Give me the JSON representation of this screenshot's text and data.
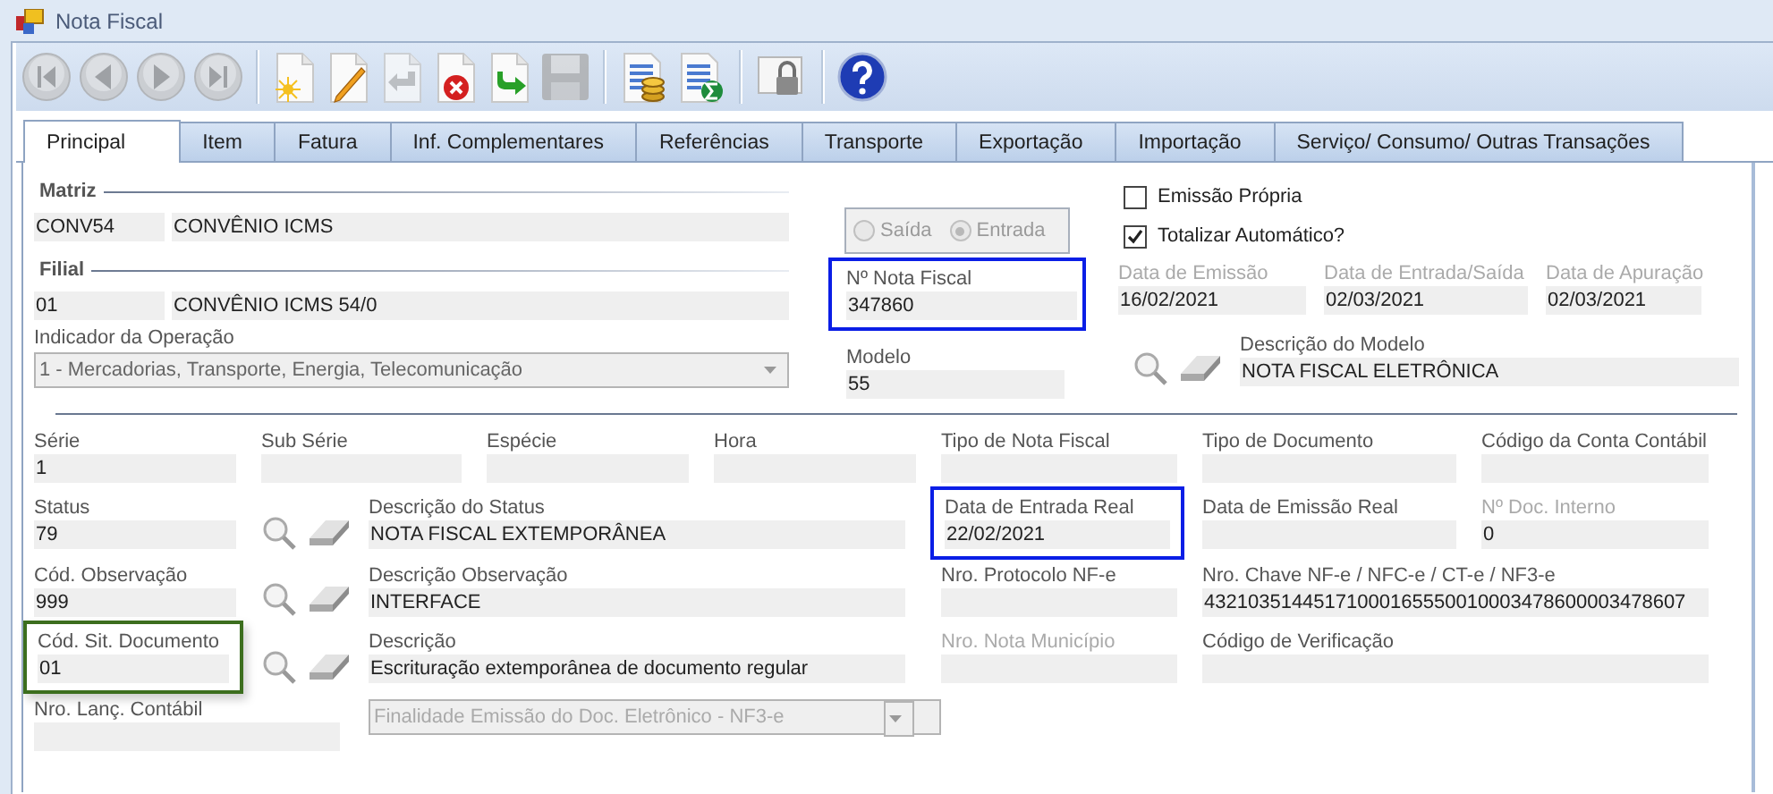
{
  "window": {
    "title": "Nota Fiscal"
  },
  "toolbar": [
    {
      "kind": "first",
      "disabled": true
    },
    {
      "kind": "prev",
      "disabled": true
    },
    {
      "kind": "next",
      "disabled": true
    },
    {
      "kind": "last",
      "disabled": true
    },
    {
      "kind": "separator"
    },
    {
      "kind": "new",
      "disabled": false
    },
    {
      "kind": "edit",
      "disabled": false
    },
    {
      "kind": "undo",
      "disabled": true
    },
    {
      "kind": "delete",
      "disabled": false
    },
    {
      "kind": "export",
      "disabled": false
    },
    {
      "kind": "save",
      "disabled": true
    },
    {
      "kind": "separator"
    },
    {
      "kind": "sheet-coins",
      "disabled": false
    },
    {
      "kind": "sheet-sum",
      "disabled": false
    },
    {
      "kind": "separator"
    },
    {
      "kind": "lock",
      "disabled": false
    },
    {
      "kind": "separator"
    },
    {
      "kind": "help",
      "disabled": false
    }
  ],
  "tabs": [
    {
      "label": "Principal",
      "selected": true
    },
    {
      "label": "Item",
      "selected": false
    },
    {
      "label": "Fatura",
      "selected": false
    },
    {
      "label": "Inf. Complementares",
      "selected": false
    },
    {
      "label": "Referências",
      "selected": false
    },
    {
      "label": "Transporte",
      "selected": false
    },
    {
      "label": "Exportação",
      "selected": false
    },
    {
      "label": "Importação",
      "selected": false
    },
    {
      "label": "Serviço/ Consumo/ Outras Transações",
      "selected": false
    }
  ],
  "matriz": {
    "title": "Matriz",
    "code": "CONV54",
    "name": "CONVÊNIO ICMS"
  },
  "filial": {
    "title": "Filial",
    "code": "01",
    "name": "CONVÊNIO ICMS 54/0"
  },
  "operation": {
    "label": "Indicador da Operação",
    "value": "1 - Mercadorias, Transporte, Energia, Telecomunicação"
  },
  "direction": {
    "disabled": true,
    "options": [
      {
        "label": "Saída",
        "selected": false
      },
      {
        "label": "Entrada",
        "selected": true
      }
    ]
  },
  "invoice_number": {
    "label": "Nº Nota Fiscal",
    "value": "347860",
    "color": "#0a1ee6"
  },
  "model": {
    "label": "Modelo",
    "value": "55"
  },
  "options": [
    {
      "label": "Emissão Própria",
      "checked": false
    },
    {
      "label": "Totalizar Automático?",
      "checked": true
    }
  ],
  "dates": [
    {
      "label": "Data de Emissão",
      "value": "16/02/2021",
      "disabled": true
    },
    {
      "label": "Data de Entrada/Saída",
      "value": "02/03/2021",
      "disabled": true
    },
    {
      "label": "Data de Apuração",
      "value": "02/03/2021",
      "disabled": true
    }
  ],
  "model_description": {
    "label": "Descrição do Modelo",
    "value": "NOTA FISCAL ELETRÔNICA"
  },
  "rows": [
    {
      "fields": [
        {
          "kind": "field",
          "label": "Série",
          "value": "1",
          "disabled": false
        },
        {
          "kind": "field",
          "label": "Sub Série",
          "disabled": false
        },
        {
          "kind": "field",
          "label": "Espécie",
          "disabled": false
        },
        {
          "kind": "field",
          "label": "Hora",
          "disabled": false
        },
        {
          "kind": "field",
          "label": "Tipo de Nota Fiscal",
          "disabled": false
        },
        {
          "kind": "field",
          "label": "Tipo de Documento",
          "disabled": false
        },
        {
          "kind": "field",
          "label": "Código da Conta Contábil",
          "disabled": false
        }
      ]
    },
    {
      "fields": [
        {
          "kind": "field",
          "label": "Status",
          "value": "79",
          "disabled": false
        },
        {
          "kind": "icons"
        },
        {
          "kind": "field",
          "label": "Descrição do Status",
          "value": "NOTA FISCAL EXTEMPORÂNEA",
          "disabled": false
        },
        {
          "kind": "field",
          "label": "Data de Entrada Real",
          "value": "22/02/2021",
          "disabled": false,
          "color": "#0a1ee6"
        },
        {
          "kind": "field",
          "label": "Data de Emissão Real",
          "disabled": false
        },
        {
          "kind": "field",
          "label": "Nº Doc. Interno",
          "value": "0",
          "disabled": true
        }
      ]
    },
    {
      "fields": [
        {
          "kind": "field",
          "label": "Cód. Observação",
          "value": "999",
          "disabled": false
        },
        {
          "kind": "icons"
        },
        {
          "kind": "field",
          "label": "Descrição Observação",
          "value": "INTERFACE",
          "disabled": false
        },
        {
          "kind": "field",
          "label": "Nro. Protocolo NF-e",
          "disabled": false
        },
        {
          "kind": "wide",
          "label": "Nro. Chave NF-e / NFC-e / CT-e / NF3-e",
          "value": "43210351445171000165550010003478600003478607",
          "disabled": false
        }
      ]
    },
    {
      "fields": [
        {
          "kind": "field",
          "label": "Cód. Sit. Documento",
          "value": "01",
          "disabled": false,
          "color": "#3c6e1e"
        },
        {
          "kind": "icons"
        },
        {
          "kind": "field",
          "label": "Descrição",
          "value": "Escrituração extemporânea de documento regular",
          "disabled": false
        },
        {
          "kind": "field",
          "label": "Nro. Nota Município",
          "disabled": true
        },
        {
          "kind": "wide",
          "label": "Código de Verificação",
          "disabled": false
        }
      ]
    },
    {
      "fields": [
        {
          "kind": "wide",
          "label": "Nro. Lanç. Contábil",
          "disabled": false
        },
        {
          "kind": "combo",
          "label": "Finalidade Emissão do Doc. Eletrônico - NF3-e",
          "disabled": true
        }
      ]
    }
  ]
}
